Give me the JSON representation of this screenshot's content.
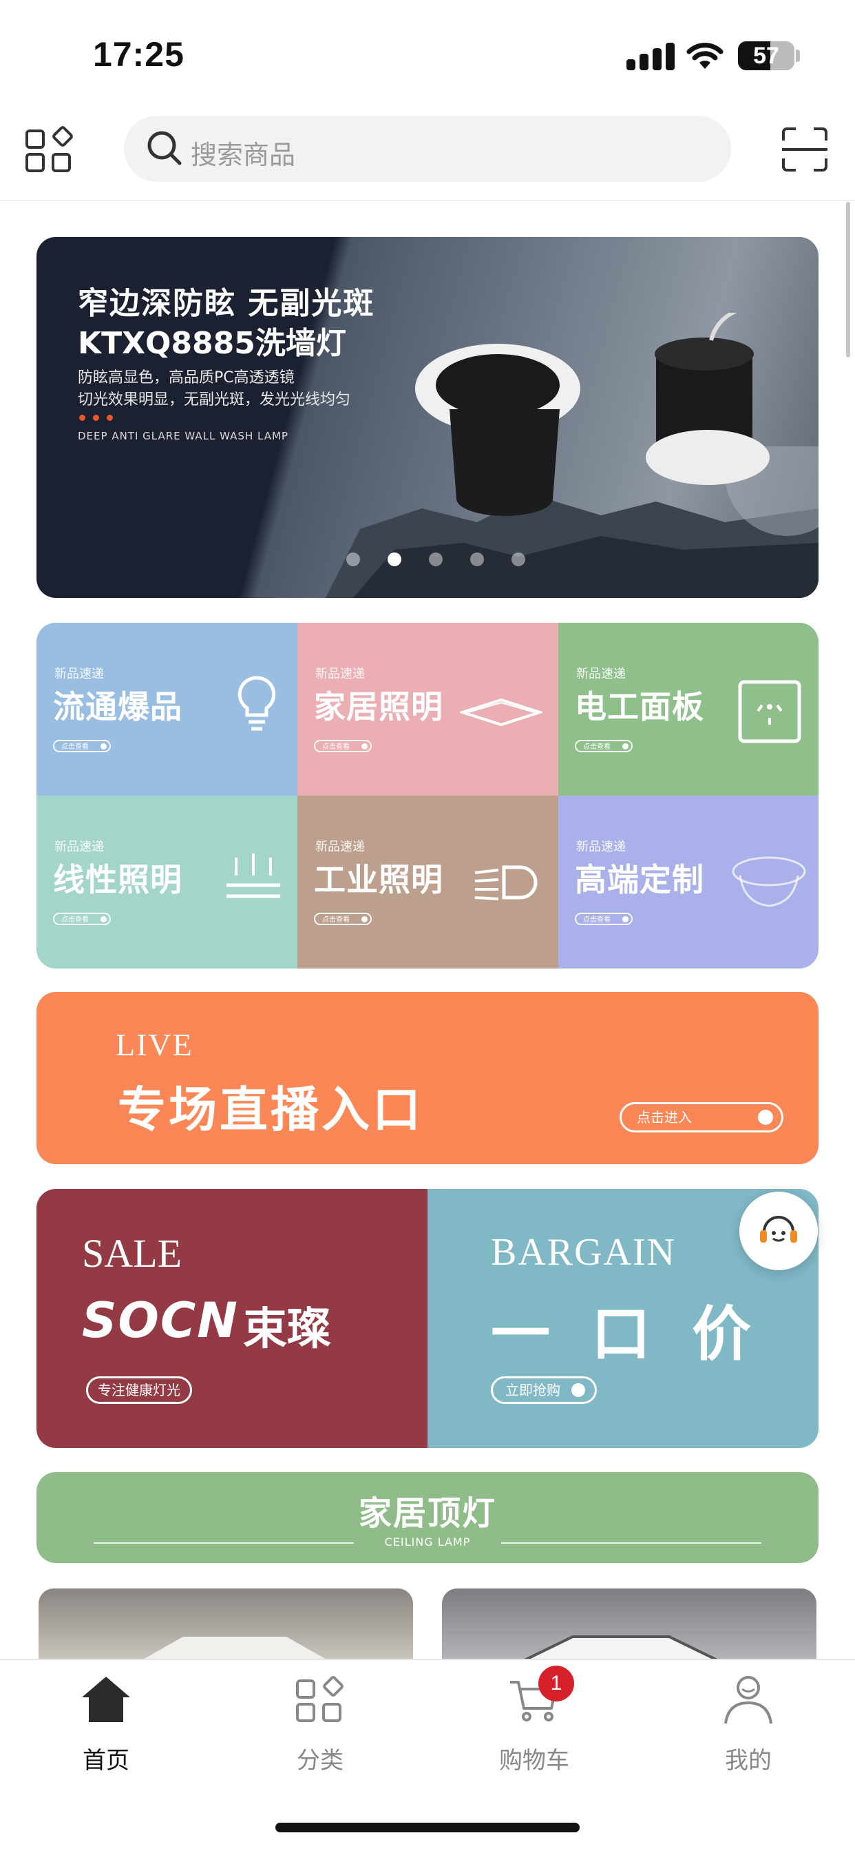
{
  "status_bar": {
    "time": "17:25",
    "battery": "57",
    "battery_level": 0.57
  },
  "search": {
    "placeholder": "搜索商品"
  },
  "banner": {
    "title_line1": "窄边深防眩 无副光斑",
    "title_line2": "KTXQ8885洗墙灯",
    "desc_line1": "防眩高显色，高品质PC高透透镜",
    "desc_line2": "切光效果明显，无副光斑，发光光线均匀",
    "english": "DEEP ANTI GLARE WALL WASH LAMP",
    "page_count": 5,
    "active_page": 2
  },
  "categories": [
    {
      "tag": "新品速递",
      "name": "流通爆品",
      "button": "点击查看",
      "color": "#9abde2",
      "icon": "bulb-icon"
    },
    {
      "tag": "新品速递",
      "name": "家居照明",
      "button": "点击查看",
      "color": "#ebaeb2",
      "icon": "ceiling-panel-icon"
    },
    {
      "tag": "新品速递",
      "name": "电工面板",
      "button": "点击查看",
      "color": "#8fc08c",
      "icon": "socket-icon"
    },
    {
      "tag": "新品速递",
      "name": "线性照明",
      "button": "点击查看",
      "color": "#a3d5cb",
      "icon": "linear-light-icon"
    },
    {
      "tag": "新品速递",
      "name": "工业照明",
      "button": "点击查看",
      "color": "#bca08d",
      "icon": "industrial-light-icon"
    },
    {
      "tag": "新品速递",
      "name": "高端定制",
      "button": "点击查看",
      "color": "#aab1ea",
      "icon": "downlight-icon"
    }
  ],
  "live": {
    "english": "LIVE",
    "title": "专场直播入口",
    "button": "点击进入",
    "color": "#fb8656"
  },
  "sale": {
    "english": "SALE",
    "logo": "SOCN",
    "logo_cn": "束璨",
    "button": "专注健康灯光",
    "color": "#943a45"
  },
  "bargain": {
    "english": "BARGAIN",
    "title": "一口价",
    "button": "立即抢购",
    "color": "#80b8c6"
  },
  "section": {
    "title": "家居顶灯",
    "subtitle": "CEILING LAMP",
    "color": "#8fbc89"
  },
  "tabs": [
    {
      "label": "首页",
      "icon": "home-icon",
      "active": true
    },
    {
      "label": "分类",
      "icon": "category-icon",
      "active": false
    },
    {
      "label": "购物车",
      "icon": "cart-icon",
      "active": false,
      "badge": "1"
    },
    {
      "label": "我的",
      "icon": "user-icon",
      "active": false
    }
  ]
}
